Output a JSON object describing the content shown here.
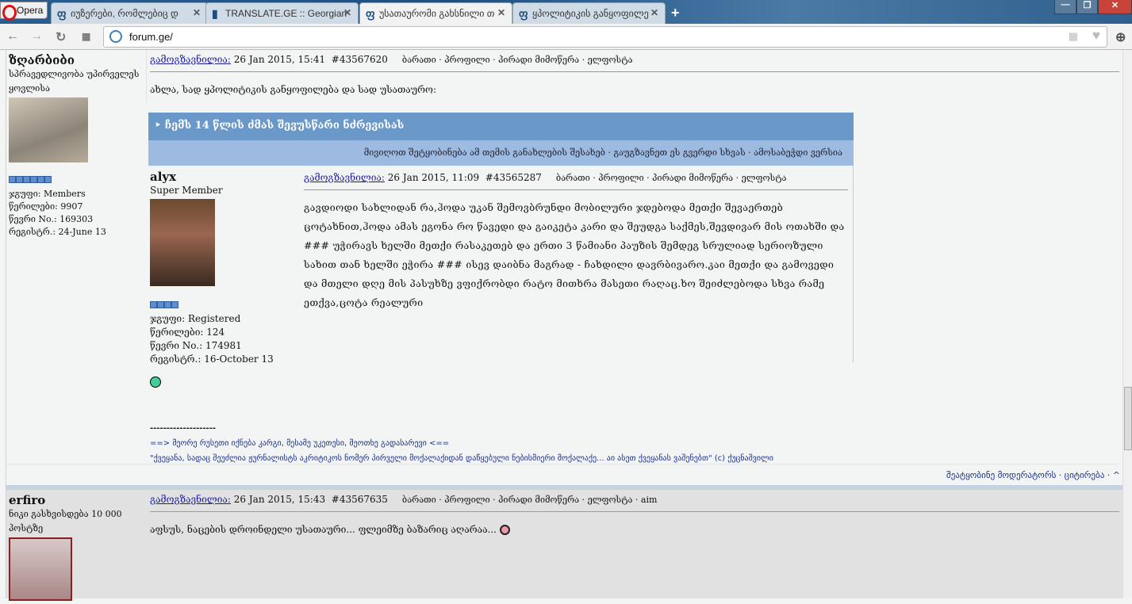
{
  "browser": {
    "menu_label": "Opera",
    "tabs": [
      {
        "title": "იუზერები, რომლებიც დ"
      },
      {
        "title": "TRANSLATE.GE :: Georgian"
      },
      {
        "title": "უსათაურომი გახსნილი თ"
      },
      {
        "title": "ყპოლიტიკის განყოფილე"
      }
    ],
    "url": "forum.ge/"
  },
  "post1": {
    "author": "ზღარბიბი",
    "title": "სპრავედლივობა უპირველეს ყოვლისა",
    "group": "ჯგუფი: Members",
    "posts": "წერილები: 9907",
    "member_no": "წევრი No.: 169303",
    "registered": "რეგისტრ.: 24-June 13",
    "sent_label": "გამოგზავნილია:",
    "date": "26 Jan 2015, 15:41",
    "id": "#43567620",
    "links": "ბარათი · პროფილი · პირადი მიმოწერა · ელფოსტა",
    "text": "ახლა, სად ყპოლიტიკის განყოფილება და სად უსათაურო:",
    "quote": {
      "topic": "ჩემს 14 წლის ძმას შევუსწარი ნძრევისას",
      "actions": "მივიღოთ შეტყობინება ამ თემის განახლების შესახებ   ·   გაუგზავნეთ ეს გვერდი სხვას   ·   ამოსაბეჭდი ვერსია",
      "author": "alyx",
      "title": "Super Member",
      "group": "ჯგუფი: Registered",
      "posts": "წერილები: 124",
      "member_no": "წევრი No.: 174981",
      "registered": "რეგისტრ.: 16-October 13",
      "sent_label": "გამოგზავნილია:",
      "date": "26 Jan 2015, 11:09",
      "id": "#43565287",
      "links": "ბარათი · პროფილი · პირადი მიმოწერა · ელფოსტა",
      "text": "გავდიოდი სახლიდან რა,ჰოდა უკან შემოვბრუნდი მობილური ჯდებოდა მეთქი შევაერთებ ცოტახნით,ჰოდა ამას ეგონა რო წავედი და გაიკეტა კარი და შეუდგა საქმეს,შევდივარ მის ოთახში და ### უჭირავს ხელში მეთქი რასაკეთებ და ერთი 3 წამიანი პაუზის შემდეგ სრულიად სერიოზული სახით თან ხელში ეჭირა ### ისევ დაიბნა მაგრად - ჩახდილი დავრბივარო.კაი მეთქი და გამოვედი და მთელი დღე მის პასუხზე ვფიქრობდი რატო მითხრა მასეთი რაღაც.ხო შეიძლებოდა სხვა რამე ეთქვა,ცოტა რეალური"
    },
    "sig_divider": "--------------------",
    "sig_line1": "==> მეორე რუსეთი იქნება კარგი, მესამე უკეთესი, მეოთხე გადასარევი <==",
    "sig_line2": "\"ქვეყანა, სადაც შეუძლია ჟურნალისტს აკრიტიკოს ნომერ პირველი მოქალაქიდან დაწყებული ნებისმიერი მოქალაქე... აი ასეთ ქვეყანას ვაშენებთ\" (c) ქუცნაშვილი",
    "footer": "შეატყობინე მოდერატორს  · ციტირება · ^"
  },
  "post2": {
    "author": "erfiro",
    "title": "ნიკი გასხვისდება 10 000 პოსტზე",
    "sent_label": "გამოგზავნილია:",
    "date": "26 Jan 2015, 15:43",
    "id": "#43567635",
    "links": "ბარათი · პროფილი · პირადი მიმოწერა · ელფოსტა · aim",
    "text": "აფსუს, ნაცების დროინდელი უსათაური... ფლეიმზე ბაზარიც აღარაა..."
  }
}
